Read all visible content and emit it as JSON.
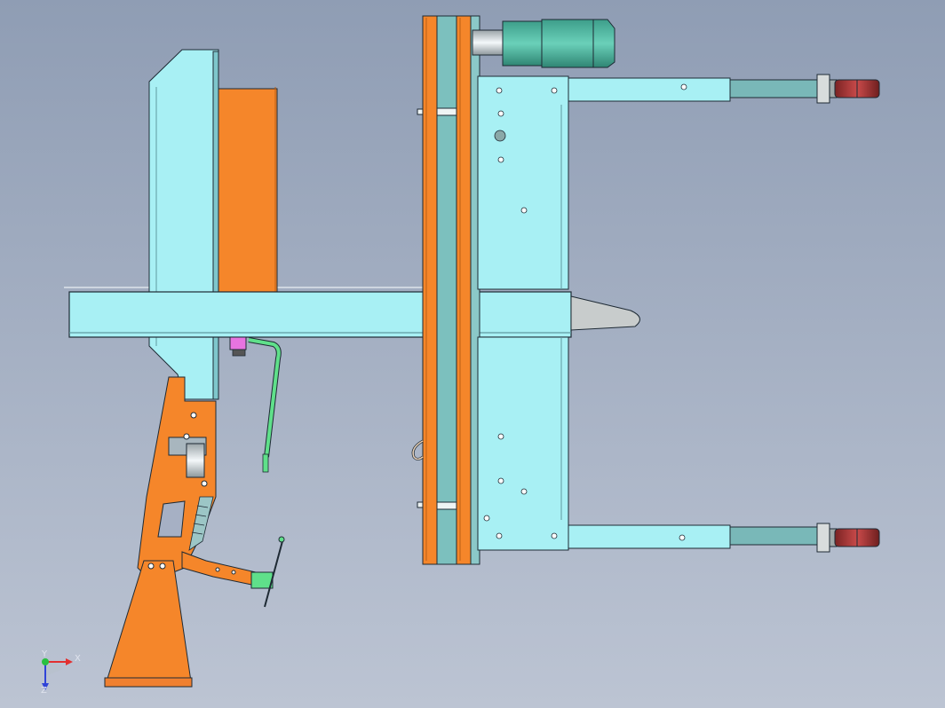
{
  "viewport": {
    "background_top": "#8f9db4",
    "background_bottom": "#bcc4d3"
  },
  "colors": {
    "frame_light": "#a8f0f4",
    "frame_dark": "#79b8b8",
    "orange": "#f5862a",
    "motor": "#4fb7a0",
    "wheel": "#b23a3a",
    "hose": "#5fe08a",
    "pink_block": "#e774e0",
    "edge": "#1e2a34"
  },
  "triad": {
    "x_label": "X",
    "y_label": "Y",
    "z_label": "Z"
  }
}
